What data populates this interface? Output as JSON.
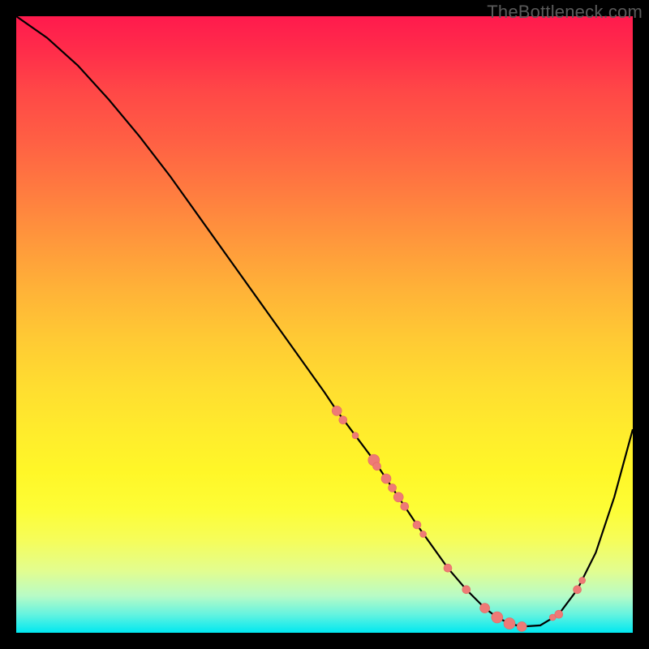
{
  "watermark": "TheBottleneck.com",
  "colors": {
    "curve": "#000000",
    "marker_fill": "#ee7a76",
    "marker_stroke": "#e46863"
  },
  "chart_data": {
    "type": "line",
    "title": "",
    "xlabel": "",
    "ylabel": "",
    "xlim": [
      0,
      100
    ],
    "ylim": [
      0,
      100
    ],
    "series": [
      {
        "name": "bottleneck-curve",
        "x": [
          0,
          5,
          10,
          15,
          20,
          25,
          30,
          35,
          40,
          45,
          50,
          52,
          55,
          58,
          60,
          62,
          65,
          70,
          73,
          76,
          78,
          80,
          82,
          85,
          88,
          91,
          94,
          97,
          100
        ],
        "y": [
          100,
          96.5,
          92,
          86.5,
          80.5,
          74,
          67,
          60,
          53,
          46,
          39,
          36,
          32,
          28,
          25,
          22,
          17.5,
          10.5,
          7,
          4,
          2.5,
          1.5,
          1,
          1.2,
          3,
          7,
          13,
          22,
          33
        ]
      }
    ],
    "markers": {
      "name": "highlight-points",
      "x": [
        52,
        53,
        55,
        58,
        58.5,
        60,
        61,
        62,
        63,
        65,
        66,
        70,
        73,
        76,
        78,
        80,
        82,
        87,
        88,
        91,
        91.8
      ],
      "y": [
        36,
        34.5,
        32,
        28,
        27,
        25,
        23.5,
        22,
        20.5,
        17.5,
        16,
        10.5,
        7,
        4,
        2.5,
        1.5,
        1,
        2.5,
        3,
        7,
        8.5
      ],
      "r": [
        6,
        5,
        4,
        7,
        5,
        6,
        5,
        6,
        5,
        5,
        4,
        5,
        5,
        6,
        7,
        7,
        6,
        4,
        5,
        5,
        4
      ]
    }
  }
}
